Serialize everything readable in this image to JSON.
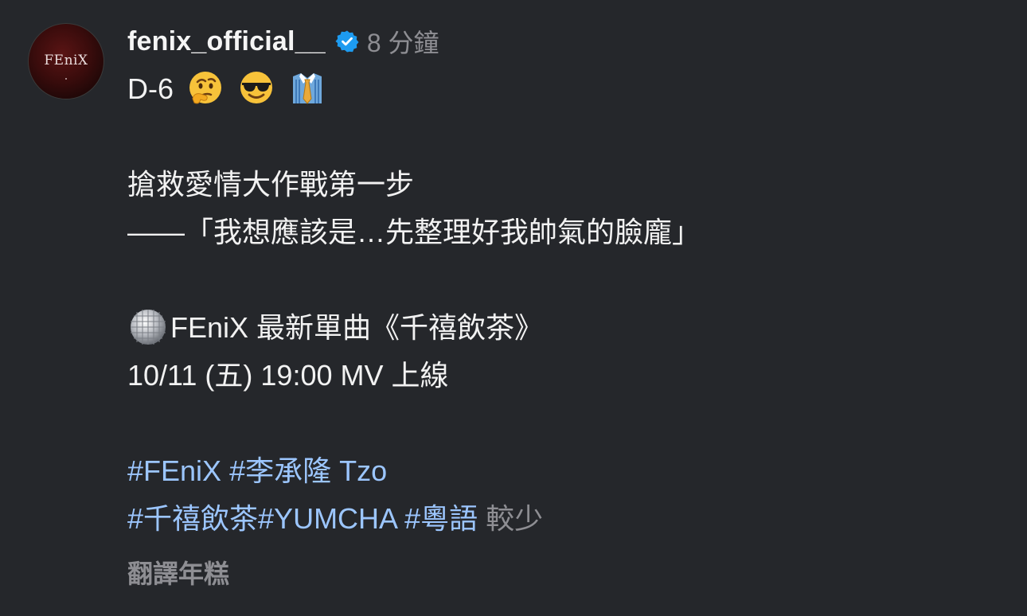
{
  "post": {
    "avatar_text": "FEniX",
    "username": "fenix_official__",
    "verified_icon": "verified-badge-icon",
    "time": "8 分鐘",
    "lines": {
      "l1": "D-6",
      "l2": "搶救愛情大作戰第一步",
      "l3": "——「我想應該是…先整理好我帥氣的臉龐」",
      "l4": "FEniX 最新單曲《千禧飲茶》",
      "l5": " 10/11 (五) 19:00 MV 上線"
    },
    "hashtags": {
      "h1": "#FEniX",
      "h2": "#李承隆 Tzo",
      "h3": "#千禧飲茶",
      "h4": "#YUMCHA",
      "h5": "#粵語"
    },
    "more": "較少",
    "translate": "翻譯年糕",
    "emojis": [
      "thinking-face",
      "sunglasses-face",
      "shirt-tie",
      "disco-ball"
    ],
    "colors": {
      "background": "#25272b",
      "hashtag": "#9cc6ff",
      "muted": "#8e8e93",
      "verified": "#1d9bf0"
    }
  }
}
